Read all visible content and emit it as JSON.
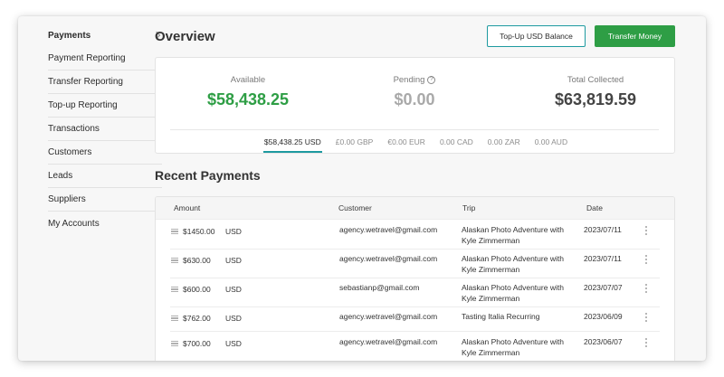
{
  "sidebar": {
    "items": [
      {
        "label": "Payments",
        "active": true
      },
      {
        "label": "Payment Reporting"
      },
      {
        "label": "Transfer Reporting"
      },
      {
        "label": "Top-up Reporting"
      },
      {
        "label": "Transactions"
      },
      {
        "label": "Customers"
      },
      {
        "label": "Leads"
      },
      {
        "label": "Suppliers"
      },
      {
        "label": "My Accounts"
      }
    ]
  },
  "header": {
    "title": "Overview",
    "topup_label": "Top-Up USD Balance",
    "transfer_label": "Transfer Money"
  },
  "overview": {
    "available_label": "Available",
    "available_value": "$58,438.25",
    "pending_label": "Pending",
    "pending_help": "?",
    "pending_value": "$0.00",
    "total_label": "Total Collected",
    "total_value": "$63,819.59"
  },
  "currencies": [
    {
      "label": "$58,438.25 USD",
      "active": true
    },
    {
      "label": "£0.00 GBP"
    },
    {
      "label": "€0.00 EUR"
    },
    {
      "label": "0.00 CAD"
    },
    {
      "label": "0.00 ZAR"
    },
    {
      "label": "0.00 AUD"
    }
  ],
  "recent": {
    "title": "Recent Payments",
    "columns": {
      "amount": "Amount",
      "customer": "Customer",
      "trip": "Trip",
      "date": "Date"
    },
    "rows": [
      {
        "amount": "$1450.00",
        "currency": "USD",
        "customer": "agency.wetravel@gmail.com",
        "trip1": "Alaskan Photo Adventure with",
        "trip2": "Kyle Zimmerman",
        "date": "2023/07/11"
      },
      {
        "amount": "$630.00",
        "currency": "USD",
        "customer": "agency.wetravel@gmail.com",
        "trip1": "Alaskan Photo Adventure with",
        "trip2": "Kyle Zimmerman",
        "date": "2023/07/11"
      },
      {
        "amount": "$600.00",
        "currency": "USD",
        "customer": "sebastianp@gmail.com",
        "trip1": "Alaskan Photo Adventure with",
        "trip2": "Kyle Zimmerman",
        "date": "2023/07/07"
      },
      {
        "amount": "$762.00",
        "currency": "USD",
        "customer": "agency.wetravel@gmail.com",
        "trip1": "Tasting Italia Recurring",
        "trip2": "",
        "date": "2023/06/09"
      },
      {
        "amount": "$700.00",
        "currency": "USD",
        "customer": "agency.wetravel@gmail.com",
        "trip1": "Alaskan Photo Adventure with",
        "trip2": "Kyle Zimmerman",
        "date": "2023/06/07"
      }
    ]
  },
  "colors": {
    "accent": "#1e9aa0",
    "primary_button": "#2e9e45",
    "available": "#2e9e45",
    "pending": "#a9a9a9"
  },
  "icons": [
    "chevron-right-icon",
    "help-icon",
    "list-icon",
    "kebab-menu-icon"
  ]
}
